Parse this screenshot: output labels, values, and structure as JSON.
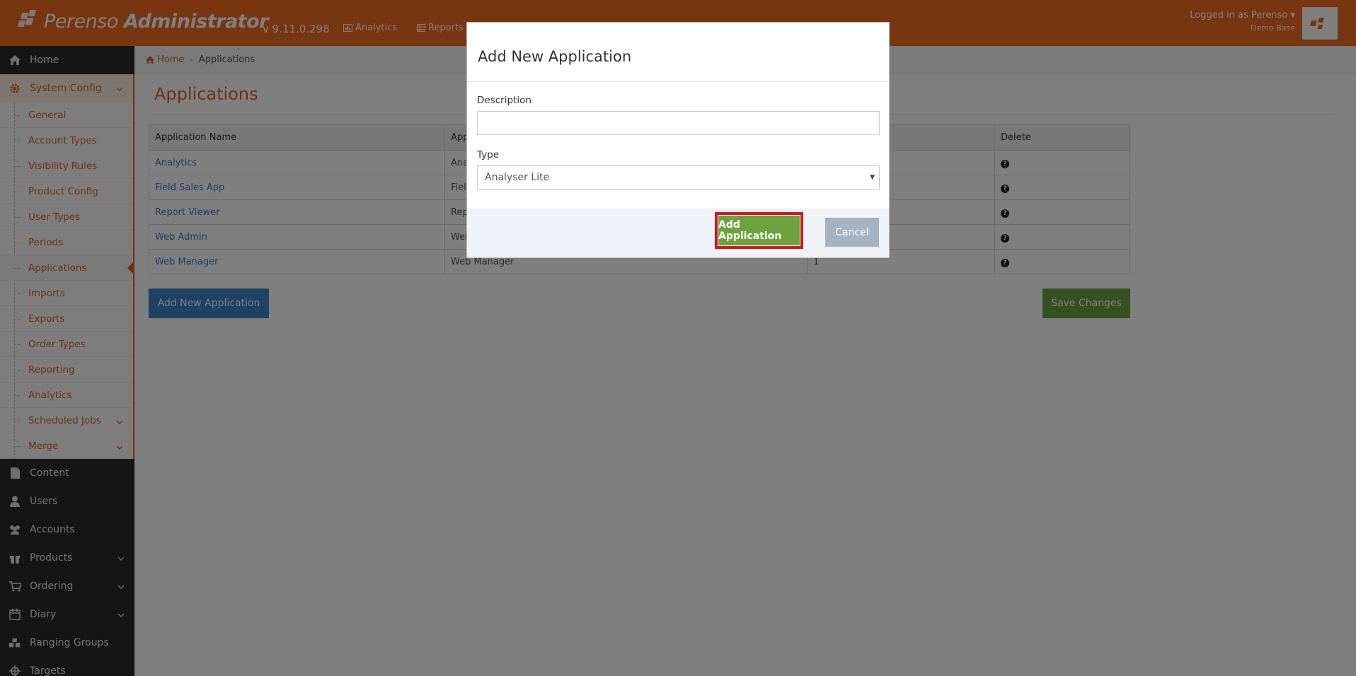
{
  "header": {
    "brand_light": "Perenso",
    "brand_bold": "Administrator",
    "version": "v 9.11.0.298",
    "nav": [
      {
        "label": "Analytics",
        "icon": "bar-chart-icon"
      },
      {
        "label": "Reports",
        "icon": "table-icon"
      }
    ],
    "user_label": "Logged in as Perenso",
    "user_base": "Demo Base"
  },
  "sidebar": {
    "home": "Home",
    "system_config": "System Config",
    "sub_items": [
      "General",
      "Account Types",
      "Visibility Rules",
      "Product Config",
      "User Types",
      "Periods",
      "Applications",
      "Imports",
      "Exports",
      "Order Types",
      "Reporting",
      "Analytics",
      "Scheduled Jobs",
      "Merge"
    ],
    "items": [
      "Content",
      "Users",
      "Accounts",
      "Products",
      "Ordering",
      "Diary",
      "Ranging Groups",
      "Targets"
    ]
  },
  "breadcrumb": {
    "home": "Home",
    "current": "Applications"
  },
  "page": {
    "title": "Applications"
  },
  "table": {
    "headers": [
      "Application Name",
      "App",
      "",
      "Delete"
    ],
    "rows": [
      {
        "name": "Analytics",
        "type": "Ana",
        "count": ""
      },
      {
        "name": "Field Sales App",
        "type": "Fiel",
        "count": ""
      },
      {
        "name": "Report Viewer",
        "type": "Rep",
        "count": ""
      },
      {
        "name": "Web Admin",
        "type": "Wel",
        "count": ""
      },
      {
        "name": "Web Manager",
        "type": "Web Manager",
        "count": "1"
      }
    ]
  },
  "buttons": {
    "add_new": "Add New Application",
    "save": "Save Changes"
  },
  "modal": {
    "title": "Add New Application",
    "description_label": "Description",
    "description_value": "",
    "type_label": "Type",
    "type_value": "Analyser Lite",
    "add_button": "Add Application",
    "cancel_button": "Cancel"
  },
  "colors": {
    "brand": "#ee6a20",
    "accent": "#e0651e",
    "primary": "#3a84c9",
    "success": "#6da33e",
    "highlight": "#d9141e"
  }
}
